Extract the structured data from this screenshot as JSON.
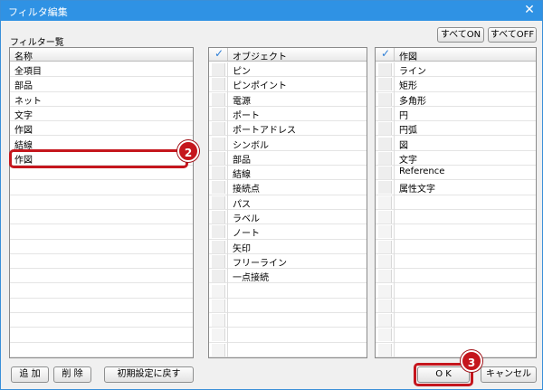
{
  "window": {
    "title": "フィルタ編集",
    "close_glyph": "✕"
  },
  "filter_list": {
    "label": "フィルター覧",
    "header": "名称",
    "items": [
      "全項目",
      "部品",
      "ネット",
      "文字",
      "作図",
      "結線",
      "作図"
    ]
  },
  "object_list": {
    "header": "オブジェクト",
    "items": [
      "ピン",
      "ピンポイント",
      "電源",
      "ポート",
      "ポートアドレス",
      "シンボル",
      "部品",
      "結線",
      "接続点",
      "パス",
      "ラベル",
      "ノート",
      "矢印",
      "フリーライン",
      "一点接続"
    ]
  },
  "drawing_list": {
    "header": "作図",
    "items": [
      "ライン",
      "矩形",
      "多角形",
      "円",
      "円弧",
      "図",
      "文字",
      "Reference",
      "属性文字"
    ]
  },
  "buttons": {
    "all_on": "すべてON",
    "all_off": "すべてOFF",
    "add": "追 加",
    "delete": "削 除",
    "reset": "初期設定に戻す",
    "ok": "O K",
    "cancel": "キャンセル"
  },
  "badges": {
    "step2": "2",
    "step3": "3"
  },
  "colors": {
    "titlebar": "#2f92e4",
    "badge": "#c5161d",
    "check": "#2f7fd6"
  }
}
